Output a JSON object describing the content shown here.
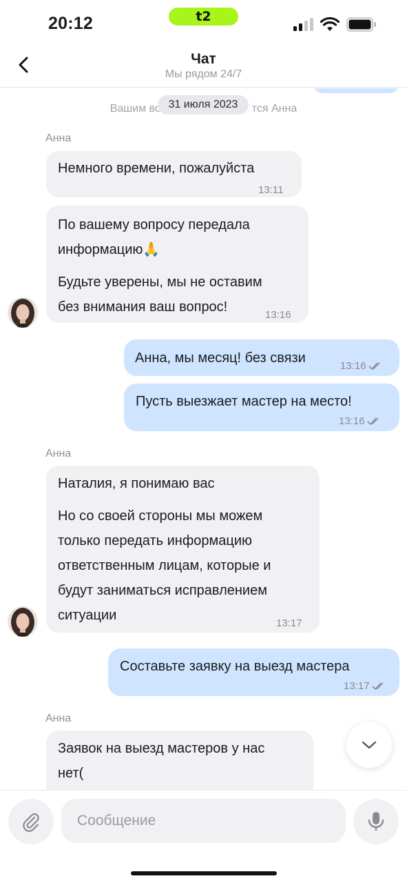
{
  "status_bar": {
    "time": "20:12",
    "carrier": "t2",
    "icons": [
      "signal-icon",
      "wifi-icon",
      "battery-icon"
    ]
  },
  "header": {
    "back_icon": "chevron-left-icon",
    "title": "Чат",
    "subtitle": "Мы рядом 24/7"
  },
  "chat": {
    "system_note_start": "Вашим во",
    "system_note_end": "тся Анна",
    "date_chip": "31 июля 2023",
    "messages": [
      {
        "sender": "Анна"
      },
      {
        "text": "Немного времени, пожалуйста",
        "time": "13:11"
      },
      {
        "lines": [
          "По вашему вопросу передала",
          "информацию🙏",
          "Будьте уверены, мы не оставим",
          "без внимания ваш вопрос!"
        ],
        "time": "13:16"
      },
      {
        "text": "Анна, мы месяц! без связи",
        "time": "13:16",
        "status": "read"
      },
      {
        "text": "Пусть выезжает мастер на место!",
        "time": "13:16",
        "status": "read"
      },
      {
        "sender": "Анна"
      },
      {
        "lines": [
          "Наталия, я понимаю вас",
          "Но со своей стороны мы можем",
          "только передать информацию",
          "ответственным лицам, которые и",
          "будут заниматься исправлением",
          "ситуации"
        ],
        "time": "13:17"
      },
      {
        "text": "Составьте заявку на выезд мастера",
        "time": "13:17",
        "status": "read"
      },
      {
        "sender": "Анна"
      },
      {
        "lines": [
          "Заявок на выезд мастеров у нас",
          "нет("
        ]
      }
    ]
  },
  "scroll_down_icon": "chevron-down-icon",
  "composer": {
    "attach_icon": "paperclip-icon",
    "placeholder": "Сообщение",
    "mic_icon": "microphone-icon"
  },
  "colors": {
    "accent": "#a8f51c",
    "outgoing_bubble": "#cfe5ff",
    "incoming_bubble": "#f1f1f3"
  }
}
